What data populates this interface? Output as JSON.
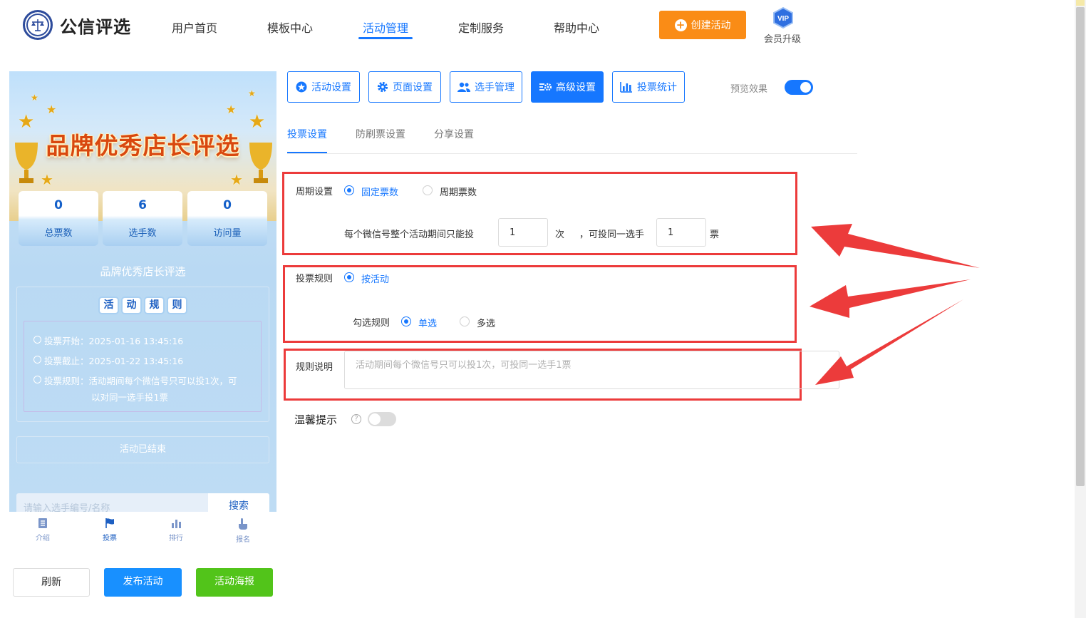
{
  "colors": {
    "primary": "#1677ff",
    "orange": "#fa8c16",
    "green": "#52c41a",
    "annotation_red": "#ec3b3b"
  },
  "header": {
    "brand": "公信评选",
    "nav": [
      "用户首页",
      "模板中心",
      "活动管理",
      "定制服务",
      "帮助中心"
    ],
    "active_nav": "活动管理",
    "create_button": "创建活动",
    "vip_badge": "VIP",
    "vip_label": "会员升级"
  },
  "preview": {
    "banner_title": "品牌优秀店长评选",
    "stats": [
      {
        "value": "0",
        "label": "总票数"
      },
      {
        "value": "6",
        "label": "选手数"
      },
      {
        "value": "0",
        "label": "访问量"
      }
    ],
    "activity_name": "品牌优秀店长评选",
    "rules_heading": [
      "活",
      "动",
      "规",
      "则"
    ],
    "rules": [
      "投票开始：2025-01-16 13:45:16",
      "投票截止：2025-01-22 13:45:16",
      "投票规则：活动期间每个微信号只可以投1次，可",
      "以对同一选手投1票"
    ],
    "ended": "活动已结束",
    "search_placeholder": "请输入选手编号/名称",
    "search_button": "搜索",
    "tabs": [
      "介绍",
      "投票",
      "排行",
      "报名"
    ],
    "active_tab": "投票"
  },
  "bottom_buttons": {
    "refresh": "刷新",
    "publish": "发布活动",
    "poster": "活动海报"
  },
  "settings_tabs": [
    "活动设置",
    "页面设置",
    "选手管理",
    "高级设置",
    "投票统计"
  ],
  "active_settings_tab": "高级设置",
  "preview_toggle": {
    "label": "预览效果",
    "on": true
  },
  "sub_tabs": [
    "投票设置",
    "防刷票设置",
    "分享设置"
  ],
  "active_sub_tab": "投票设置",
  "form": {
    "period": {
      "label": "周期设置",
      "options": [
        "固定票数",
        "周期票数"
      ],
      "selected": "固定票数",
      "sentence_prefix": "每个微信号整个活动期间只能投",
      "times_value": "1",
      "times_unit": "次",
      "sentence_mid": "，可投同一选手",
      "votes_value": "1",
      "votes_unit": "票"
    },
    "vote_rule": {
      "label": "投票规则",
      "option": "按活动",
      "check_label": "勾选规则",
      "check_options": [
        "单选",
        "多选"
      ],
      "check_selected": "单选"
    },
    "description": {
      "label": "规则说明",
      "placeholder": "活动期间每个微信号只可以投1次，可投同一选手1票"
    },
    "tip": {
      "label": "温馨提示",
      "help": "?",
      "on": false
    }
  }
}
